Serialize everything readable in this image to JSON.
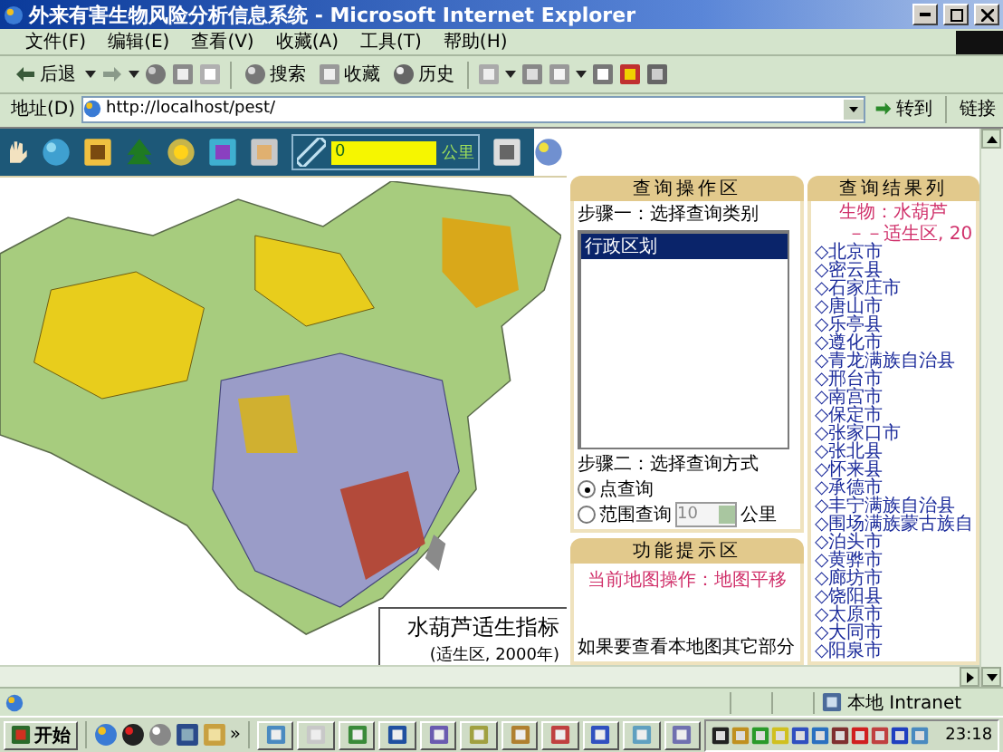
{
  "window": {
    "title": "外来有害生物风险分析信息系统 - Microsoft Internet Explorer"
  },
  "menu": [
    "文件(F)",
    "编辑(E)",
    "查看(V)",
    "收藏(A)",
    "工具(T)",
    "帮助(H)"
  ],
  "toolbar": {
    "back": "后退",
    "search": "搜索",
    "favorites": "收藏",
    "history": "历史"
  },
  "address_bar": {
    "label": "地址(D)",
    "value": "http://localhost/pest/",
    "go": "转到",
    "links": "链接"
  },
  "map_toolbar": {
    "distance": "0",
    "unit": "公里"
  },
  "map": {
    "legend_title": "水葫芦适生指标",
    "legend_subtitle": "(适生区, 2000年)"
  },
  "query_panel": {
    "title": "查询操作区",
    "step1": "步骤一：选择查询类别",
    "categories": [
      {
        "label": "行政区划",
        "selected": true
      }
    ],
    "step2": "步骤二：选择查询方式",
    "modes": [
      {
        "label": "点查询",
        "selected": true
      },
      {
        "label": "范围查询",
        "selected": false
      }
    ],
    "range_value": "10",
    "range_unit": "公里"
  },
  "function_panel": {
    "title": "功能提示区",
    "current": "当前地图操作：地图平移",
    "hint": "如果要查看本地图其它部分"
  },
  "results_panel": {
    "title": "查询结果列",
    "organism": "生物：水葫芦",
    "subtitle": "－－适生区, 20",
    "items": [
      "◇北京市",
      "◇密云县",
      "◇石家庄市",
      "◇唐山市",
      "◇乐亭县",
      "◇遵化市",
      "◇青龙满族自治县",
      "◇邢台市",
      "◇南宫市",
      "◇保定市",
      "◇张家口市",
      "◇张北县",
      "◇怀来县",
      "◇承德市",
      "◇丰宁满族自治县",
      "◇围场满族蒙古族自",
      "◇泊头市",
      "◇黄骅市",
      "◇廊坊市",
      "◇饶阳县",
      "◇太原市",
      "◇大同市",
      "◇阳泉市"
    ]
  },
  "status_bar": {
    "zone": "本地 Intranet"
  },
  "taskbar": {
    "start": "开始",
    "quick_launch_more": "»",
    "clock": "23:18"
  }
}
